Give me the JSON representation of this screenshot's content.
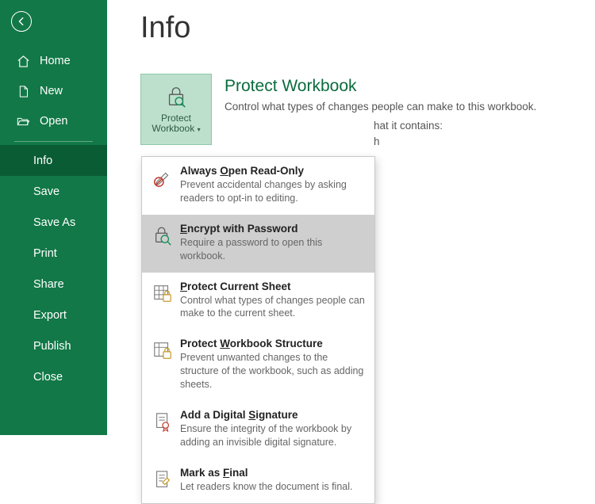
{
  "sidebar": {
    "home": "Home",
    "new": "New",
    "open": "Open",
    "info": "Info",
    "save": "Save",
    "saveas": "Save As",
    "print": "Print",
    "share": "Share",
    "export": "Export",
    "publish": "Publish",
    "close": "Close"
  },
  "page": {
    "title": "Info"
  },
  "protect": {
    "button_line1": "Protect",
    "button_line2": "Workbook",
    "title": "Protect Workbook",
    "desc": "Control what types of changes people can make to this workbook."
  },
  "peek": {
    "line1": "hat it contains:",
    "line2": "h"
  },
  "menu": {
    "items": [
      {
        "title_pre": "Always ",
        "title_ul": "O",
        "title_post": "pen Read-Only",
        "desc": "Prevent accidental changes by asking readers to opt-in to editing."
      },
      {
        "title_pre": "",
        "title_ul": "E",
        "title_post": "ncrypt with Password",
        "desc": "Require a password to open this workbook."
      },
      {
        "title_pre": "",
        "title_ul": "P",
        "title_post": "rotect Current Sheet",
        "desc": "Control what types of changes people can make to the current sheet."
      },
      {
        "title_pre": "Protect ",
        "title_ul": "W",
        "title_post": "orkbook Structure",
        "desc": "Prevent unwanted changes to the structure of the workbook, such as adding sheets."
      },
      {
        "title_pre": "Add a Digital ",
        "title_ul": "S",
        "title_post": "ignature",
        "desc": "Ensure the integrity of the workbook by adding an invisible digital signature."
      },
      {
        "title_pre": "Mark as ",
        "title_ul": "F",
        "title_post": "inal",
        "desc": "Let readers know the document is final."
      }
    ]
  }
}
